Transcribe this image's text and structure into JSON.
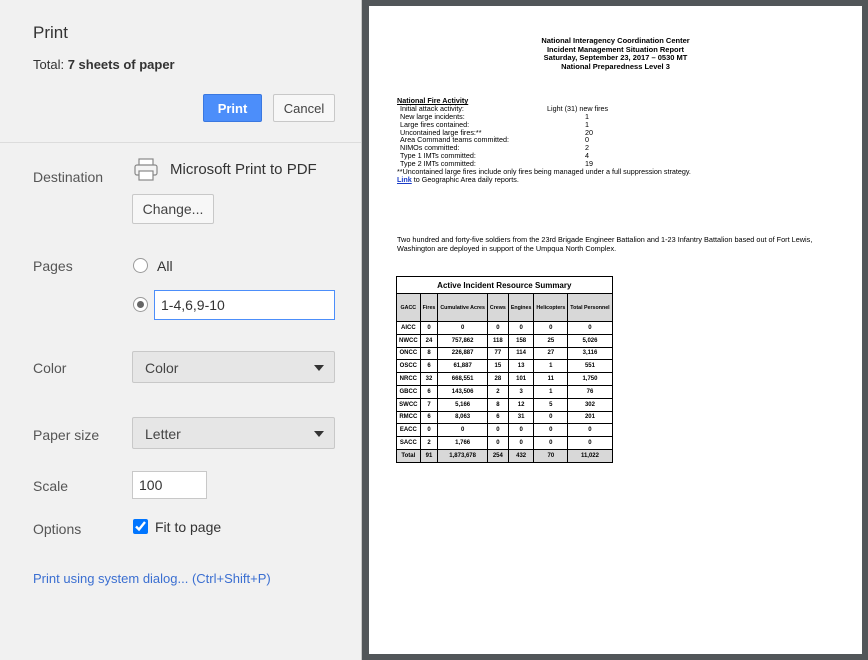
{
  "header": {
    "title": "Print",
    "total_prefix": "Total: ",
    "total_value": "7 sheets of paper",
    "print_button": "Print",
    "cancel_button": "Cancel"
  },
  "destination": {
    "label": "Destination",
    "icon": "printer-icon",
    "printer": "Microsoft Print to PDF",
    "change_button": "Change..."
  },
  "pages": {
    "label": "Pages",
    "all_label": "All",
    "custom_value": "1-4,6,9-10",
    "selected": "custom"
  },
  "color": {
    "label": "Color",
    "value": "Color"
  },
  "paper_size": {
    "label": "Paper size",
    "value": "Letter"
  },
  "scale": {
    "label": "Scale",
    "value": "100"
  },
  "options": {
    "label": "Options",
    "fit_to_page": "Fit to page",
    "fit_checked": true
  },
  "system_dialog_link": "Print using system dialog... (Ctrl+Shift+P)",
  "colors": {
    "accent": "#4c8efa",
    "panel_bg": "#f1f1f1",
    "preview_bg": "#525659",
    "link": "#3b6fd1"
  },
  "preview": {
    "head_lines": [
      "National Interagency Coordination Center",
      "Incident Management Situation Report",
      "Saturday, September 23, 2017 – 0530 MT",
      "National Preparedness Level 3"
    ],
    "fire_activity_title": "National Fire Activity",
    "fire_initial_label": "Initial attack activity:",
    "fire_initial_value": "Light (31) new fires",
    "fire_rows": [
      {
        "k": "New large incidents:",
        "v": "1"
      },
      {
        "k": "Large fires contained:",
        "v": "1"
      },
      {
        "k": "Uncontained large fires:**",
        "v": "20"
      },
      {
        "k": "Area Command teams committed:",
        "v": "0"
      },
      {
        "k": "NIMOs committed:",
        "v": "2"
      },
      {
        "k": "Type 1 IMTs committed:",
        "v": "4"
      },
      {
        "k": "Type 2 IMTs committed:",
        "v": "19"
      }
    ],
    "uncontained_note": "**Uncontained large fires include only fires being managed under a full suppression strategy.",
    "link_word": "Link",
    "link_rest": " to Geographic Area daily reports.",
    "soldiers_text": "Two hundred and forty-five soldiers from the 23rd Brigade Engineer Battalion and 1-23 Infantry Battalion based out of Fort Lewis, Washington are deployed in support of the Umpqua North Complex.",
    "table_title": "Active Incident Resource Summary",
    "table_headers": [
      "GACC",
      "Fires",
      "Cumulative Acres",
      "Crews",
      "Engines",
      "Helicopters",
      "Total Personnel"
    ],
    "table_rows": [
      [
        "AICC",
        "0",
        "0",
        "0",
        "0",
        "0",
        "0"
      ],
      [
        "NWCC",
        "24",
        "757,862",
        "118",
        "158",
        "25",
        "5,026"
      ],
      [
        "ONCC",
        "8",
        "226,887",
        "77",
        "114",
        "27",
        "3,116"
      ],
      [
        "OSCC",
        "6",
        "61,887",
        "15",
        "13",
        "1",
        "551"
      ],
      [
        "NRCC",
        "32",
        "668,551",
        "28",
        "101",
        "11",
        "1,750"
      ],
      [
        "GBCC",
        "6",
        "143,506",
        "2",
        "3",
        "1",
        "76"
      ],
      [
        "SWCC",
        "7",
        "5,166",
        "8",
        "12",
        "5",
        "302"
      ],
      [
        "RMCC",
        "6",
        "8,063",
        "6",
        "31",
        "0",
        "201"
      ],
      [
        "EACC",
        "0",
        "0",
        "0",
        "0",
        "0",
        "0"
      ],
      [
        "SACC",
        "2",
        "1,766",
        "0",
        "0",
        "0",
        "0"
      ]
    ],
    "table_total": [
      "Total",
      "91",
      "1,873,678",
      "254",
      "432",
      "70",
      "11,022"
    ]
  }
}
